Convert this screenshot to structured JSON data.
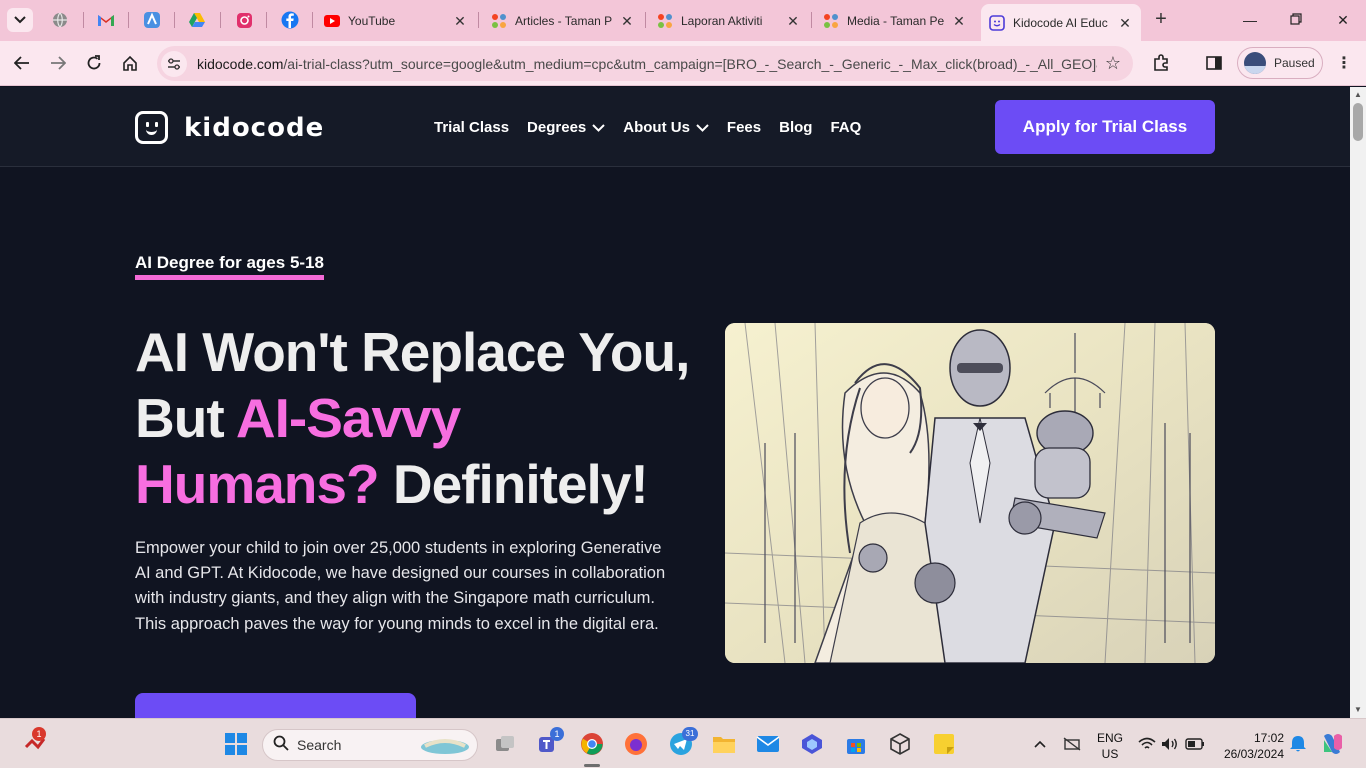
{
  "browser": {
    "tabs": [
      {
        "title": "YouTube",
        "favicon": "youtube-icon"
      },
      {
        "title": "Articles - Taman P",
        "favicon": "joomla-icon"
      },
      {
        "title": "Laporan Aktiviti",
        "favicon": "joomla-icon"
      },
      {
        "title": "Media - Taman Pe",
        "favicon": "joomla-icon"
      },
      {
        "title": "Kidocode AI Educ",
        "favicon": "kidocode-icon",
        "active": true
      }
    ],
    "pinned": [
      "globe-icon",
      "gmail-icon",
      "adaptive-icon",
      "drive-icon",
      "instagram-icon",
      "facebook-icon"
    ],
    "url_domain": "kidocode.com",
    "url_path": "/ai-trial-class?utm_source=google&utm_medium=cpc&utm_campaign=[BRO_-_Search_-_Generic_-_Max_click(broad)_-_All_GEO]&...",
    "profile_status": "Paused"
  },
  "site": {
    "logo_text": "kidocode",
    "nav": [
      {
        "label": "Trial Class",
        "dropdown": false
      },
      {
        "label": "Degrees",
        "dropdown": true
      },
      {
        "label": "About Us",
        "dropdown": true
      },
      {
        "label": "Fees",
        "dropdown": false
      },
      {
        "label": "Blog",
        "dropdown": false
      },
      {
        "label": "FAQ",
        "dropdown": false
      }
    ],
    "cta_label": "Apply for Trial Class",
    "accent_color": "#6c4cf5",
    "highlight_color": "#f76ee0"
  },
  "hero": {
    "eyebrow": "AI Degree for ages 5-18",
    "headline_part1": "AI Won't Replace You, But ",
    "headline_highlight": "AI-Savvy Humans?",
    "headline_part2": " Definitely!",
    "body": "Empower your child to join over 25,000 students in exploring Generative AI and GPT. At Kidocode, we have designed our courses in collaboration with industry giants, and they align with the Singapore math curriculum. This approach paves the way for young minds to excel in the digital era."
  },
  "taskbar": {
    "search_placeholder": "Search",
    "language": "ENG",
    "region": "US",
    "time": "17:02",
    "date": "26/03/2024",
    "notification_badges": {
      "alerts": "1",
      "teams": "1",
      "telegram": "31"
    }
  }
}
